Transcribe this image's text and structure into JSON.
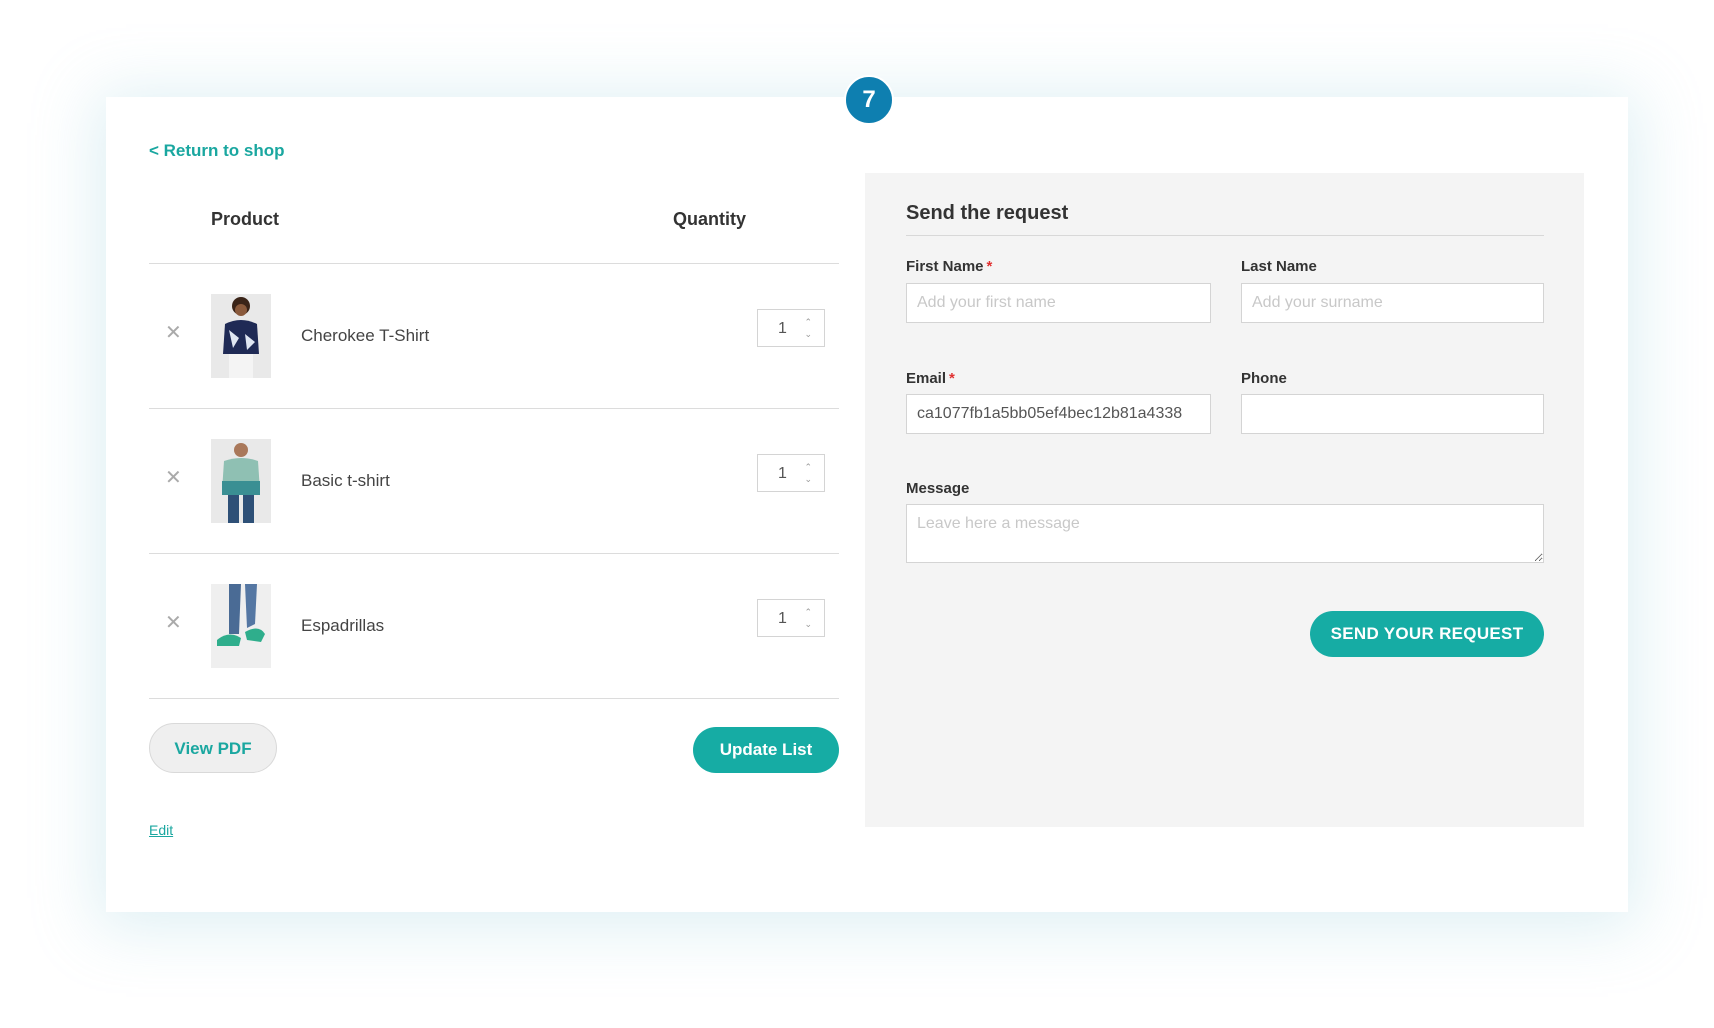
{
  "step_badge": "7",
  "return_link": "< Return to shop",
  "table": {
    "product_header": "Product",
    "quantity_header": "Quantity",
    "rows": [
      {
        "name": "Cherokee T-Shirt",
        "qty": "1"
      },
      {
        "name": "Basic t-shirt",
        "qty": "1"
      },
      {
        "name": "Espadrillas",
        "qty": "1"
      }
    ]
  },
  "buttons": {
    "view_pdf": "View PDF",
    "update_list": "Update List",
    "edit": "Edit"
  },
  "form": {
    "title": "Send the request",
    "first_name_label": "First Name",
    "first_name_placeholder": "Add your first name",
    "last_name_label": "Last Name",
    "last_name_placeholder": "Add your surname",
    "email_label": "Email",
    "email_value": "ca1077fb1a5bb05ef4bec12b81a4338",
    "phone_label": "Phone",
    "message_label": "Message",
    "message_placeholder": "Leave here a message",
    "required_mark": "*",
    "submit": "SEND YOUR REQUEST"
  },
  "colors": {
    "accent": "#16aca4",
    "badge": "#0e7fb0",
    "required": "#e03030"
  }
}
